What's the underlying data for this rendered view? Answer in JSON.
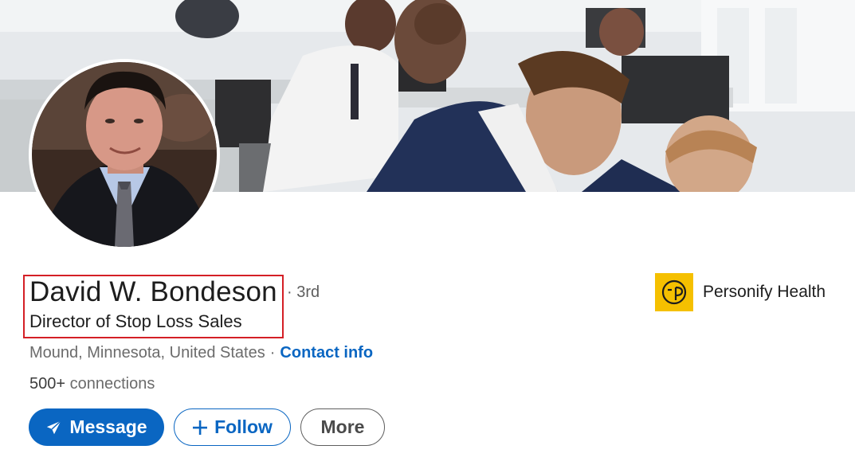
{
  "profile": {
    "name": "David W. Bondeson",
    "degree": "· 3rd",
    "headline": "Director of Stop Loss Sales",
    "location": "Mound, Minnesota, United States",
    "separator": "·",
    "contact_info_label": "Contact info",
    "connections_count": "500+",
    "connections_label": "connections"
  },
  "actions": {
    "message_label": "Message",
    "follow_label": "Follow",
    "more_label": "More"
  },
  "company": {
    "name": "Personify Health",
    "logo_color": "#f5c000"
  },
  "colors": {
    "primary": "#0a66c2",
    "highlight_border": "#d41f26"
  },
  "icons": {
    "message": "paper-plane-icon",
    "follow": "plus-icon"
  }
}
